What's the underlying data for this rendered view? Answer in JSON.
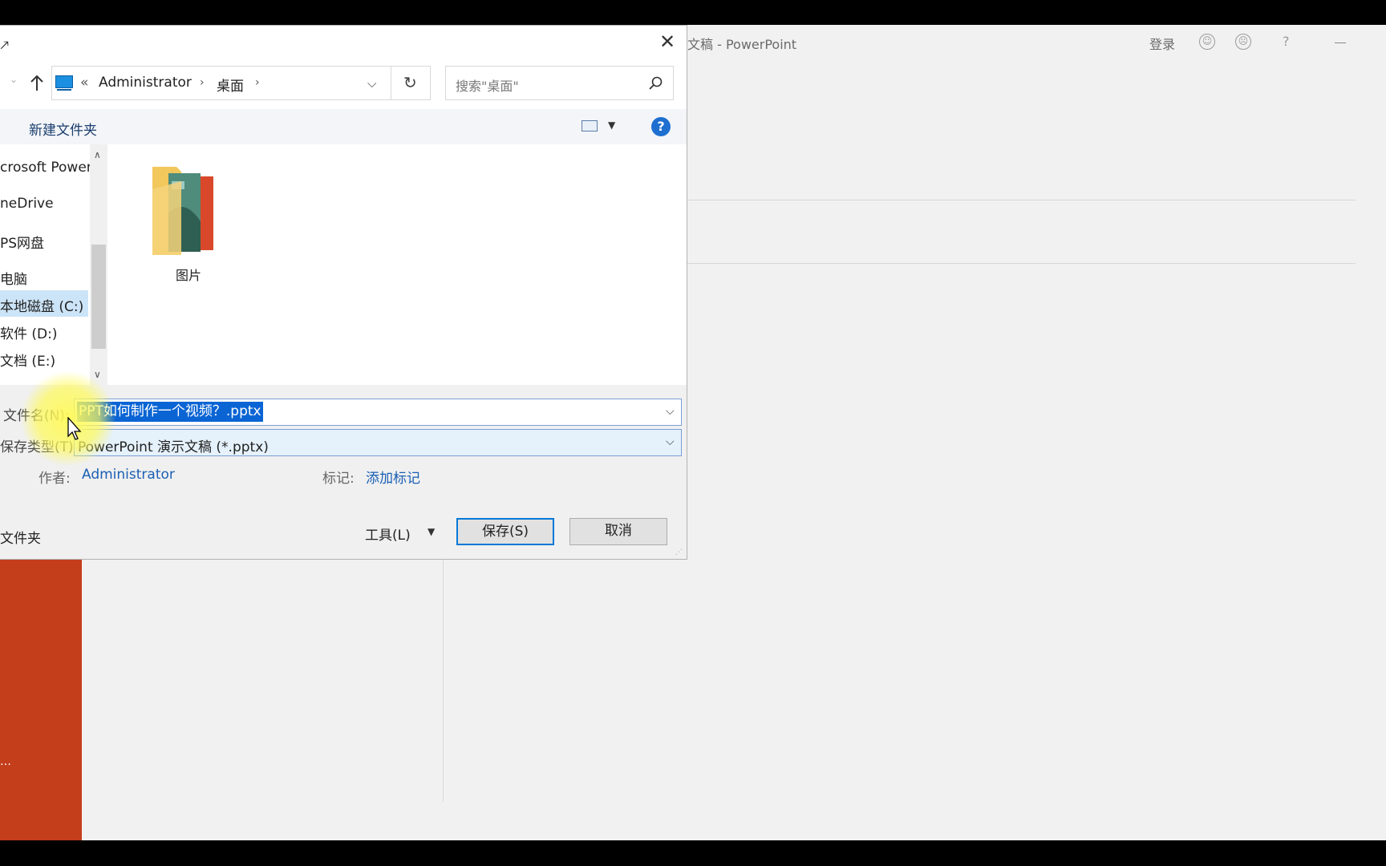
{
  "powerpoint": {
    "title": "文稿 - PowerPoint",
    "login": "登录",
    "help": "?"
  },
  "dialog": {
    "address": {
      "crumbs": [
        "«",
        "Administrator",
        "桌面"
      ]
    },
    "search": {
      "placeholder": "搜索\"桌面\""
    },
    "toolbar": {
      "new_folder": "新建文件夹"
    },
    "nav_items": [
      "crosoft Power",
      "neDrive",
      "PS网盘",
      "电脑",
      "本地磁盘 (C:)",
      "软件 (D:)",
      "文档 (E:)"
    ],
    "files": [
      {
        "name": "图片"
      }
    ],
    "filename": {
      "label": "文件名(N):",
      "value": "PPT如何制作一个视频？.pptx"
    },
    "filetype": {
      "label": "保存类型(T):",
      "value": "PowerPoint 演示文稿 (*.pptx)"
    },
    "author": {
      "label": "作者:",
      "value": "Administrator"
    },
    "tags": {
      "label": "标记:",
      "value": "添加标记"
    },
    "hide_folders": "文件夹",
    "tools_label": "工具(L)",
    "save_label": "保存(S)",
    "cancel_label": "取消"
  },
  "colors": {
    "accent": "#c43e1c",
    "selection": "#0a64d4",
    "link": "#1a5fb4"
  },
  "icons": [
    "monitor-icon",
    "up-arrow-icon",
    "refresh-icon",
    "search-icon",
    "view-icon",
    "help-icon",
    "folder-icon",
    "close-icon"
  ]
}
